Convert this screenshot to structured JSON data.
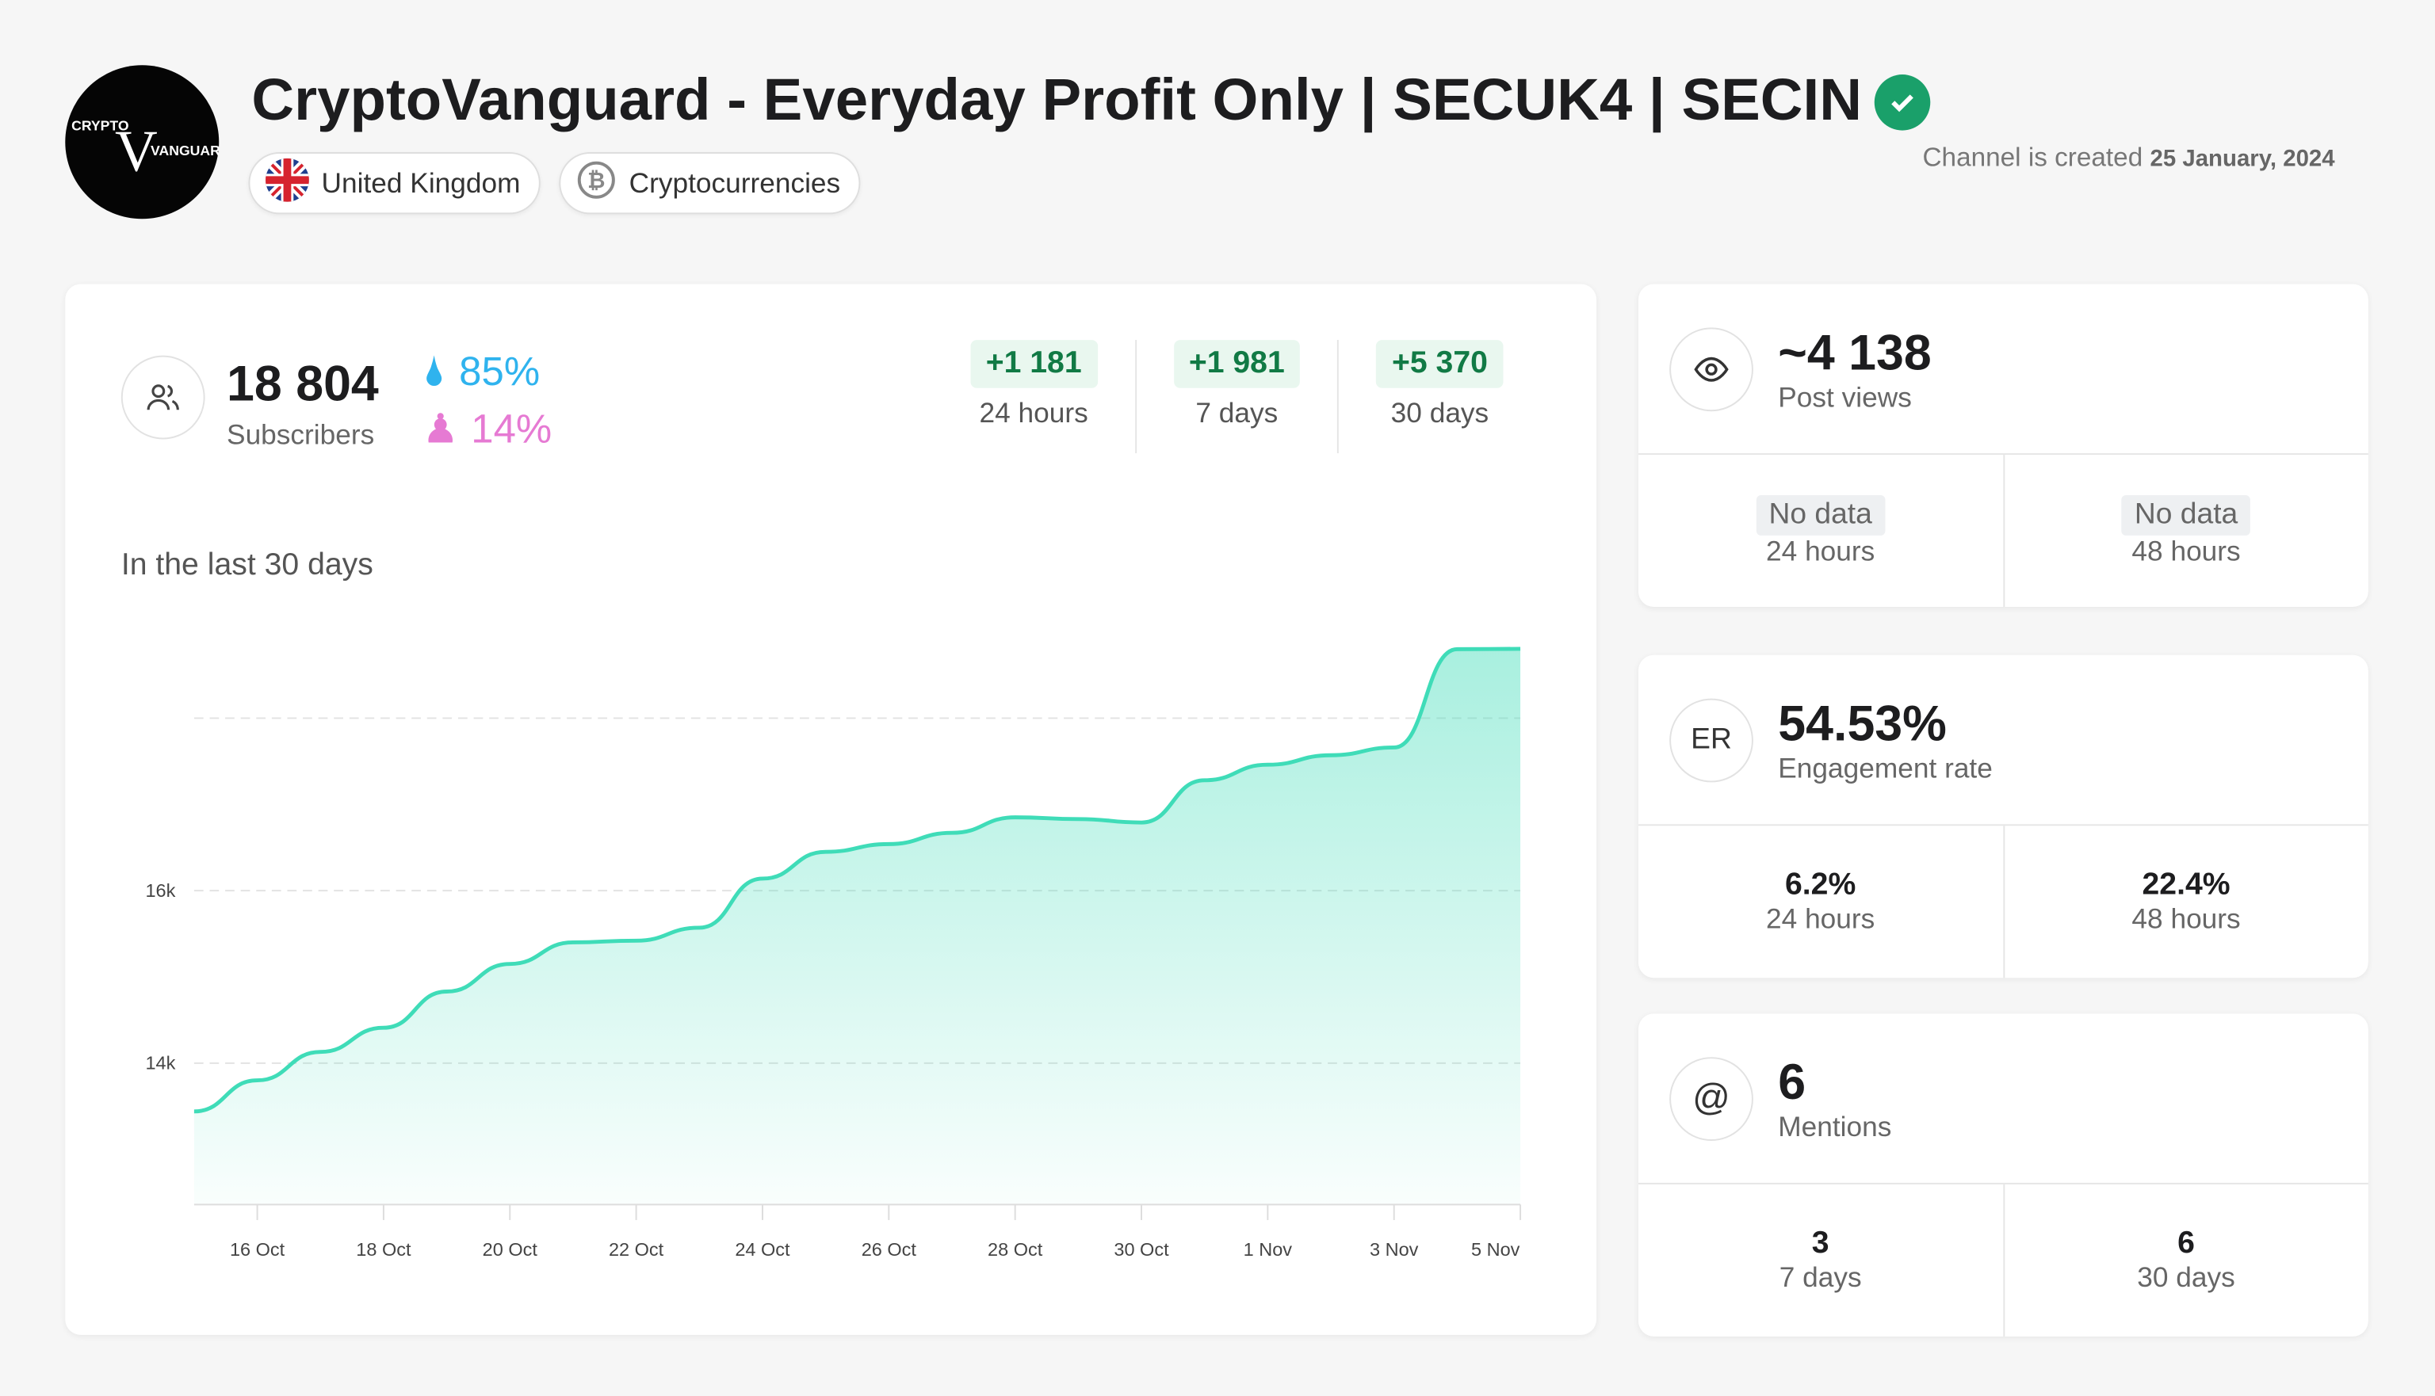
{
  "channel": {
    "title": "CryptoVanguard - Everyday Profit Only | SECUK4 | SECIN",
    "logo_text": "CRYPTO VC VANGUARD",
    "country": "United Kingdom",
    "category": "Cryptocurrencies",
    "created_label": "Channel is created",
    "created_date": "25 January, 2024",
    "verified": true
  },
  "subscribers": {
    "count": "18 804",
    "label": "Subscribers",
    "male": "85%",
    "female": "14%",
    "male_color": "#2fb3ee",
    "female_color": "#e67ad3",
    "growth": [
      {
        "value": "+1 181",
        "label": "24 hours"
      },
      {
        "value": "+1 981",
        "label": "7 days"
      },
      {
        "value": "+5 370",
        "label": "30 days"
      }
    ]
  },
  "chart_section_title": "In the last 30 days",
  "chart_data": {
    "type": "area",
    "color": "#3fdcb8",
    "grid": true,
    "x": [
      "15 Oct",
      "16 Oct",
      "17 Oct",
      "18 Oct",
      "19 Oct",
      "20 Oct",
      "21 Oct",
      "22 Oct",
      "23 Oct",
      "24 Oct",
      "25 Oct",
      "26 Oct",
      "27 Oct",
      "28 Oct",
      "29 Oct",
      "30 Oct",
      "31 Oct",
      "1 Nov",
      "2 Nov",
      "3 Nov",
      "4 Nov",
      "5 Nov"
    ],
    "values": [
      13440,
      13800,
      14130,
      14410,
      14830,
      15150,
      15400,
      15420,
      15570,
      16140,
      16450,
      16540,
      16670,
      16850,
      16830,
      16790,
      17280,
      17460,
      17570,
      17660,
      18800,
      18804
    ],
    "x_ticks": [
      "16 Oct",
      "18 Oct",
      "20 Oct",
      "22 Oct",
      "24 Oct",
      "26 Oct",
      "28 Oct",
      "30 Oct",
      "1 Nov",
      "3 Nov",
      "5 Nov"
    ],
    "y_ticks": [
      {
        "value": 14000,
        "label": "14k"
      },
      {
        "value": 16000,
        "label": "16k"
      },
      {
        "value": 18000,
        "label": ""
      }
    ],
    "ylim": [
      12360,
      18804
    ]
  },
  "views": {
    "value": "~4 138",
    "label": "Post views",
    "items": [
      {
        "value": "No data",
        "label": "24 hours"
      },
      {
        "value": "No data",
        "label": "48 hours"
      }
    ]
  },
  "er": {
    "icon_text": "ER",
    "value": "54.53%",
    "label": "Engagement rate",
    "items": [
      {
        "value": "6.2%",
        "label": "24 hours"
      },
      {
        "value": "22.4%",
        "label": "48 hours"
      }
    ]
  },
  "mentions": {
    "icon_text": "@",
    "value": "6",
    "label": "Mentions",
    "items": [
      {
        "value": "3",
        "label": "7 days"
      },
      {
        "value": "6",
        "label": "30 days"
      }
    ]
  }
}
